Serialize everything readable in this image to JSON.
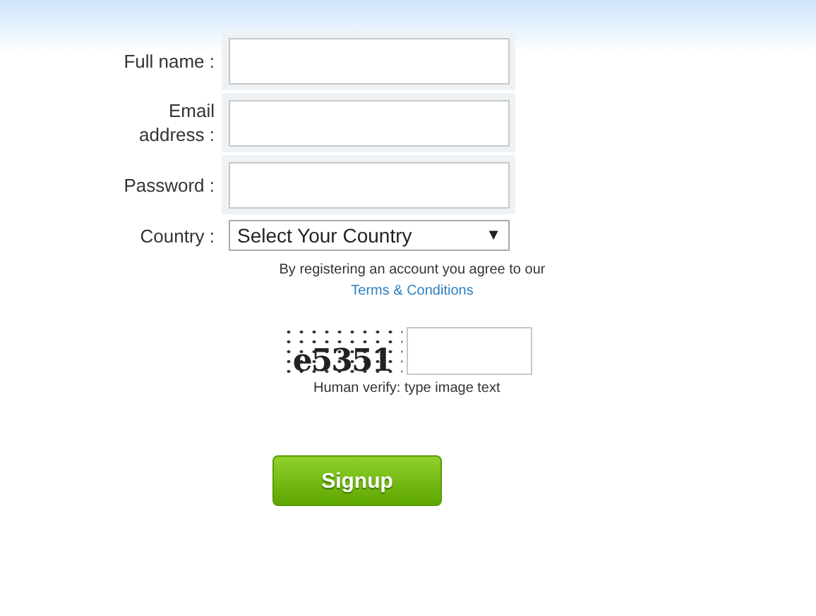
{
  "fields": [
    {
      "label": "Full name :"
    },
    {
      "label": "Email address :"
    },
    {
      "label": "Password :"
    }
  ],
  "country": {
    "label": "Country :",
    "value": "Select Your Country",
    "arrow": "▼"
  },
  "terms": {
    "text": "By registering an account you agree to our ",
    "link": "Terms & Conditions"
  },
  "captcha": {
    "image_text": "e5351",
    "caption": "Human verify: type image text"
  },
  "signup_button": "Signup"
}
